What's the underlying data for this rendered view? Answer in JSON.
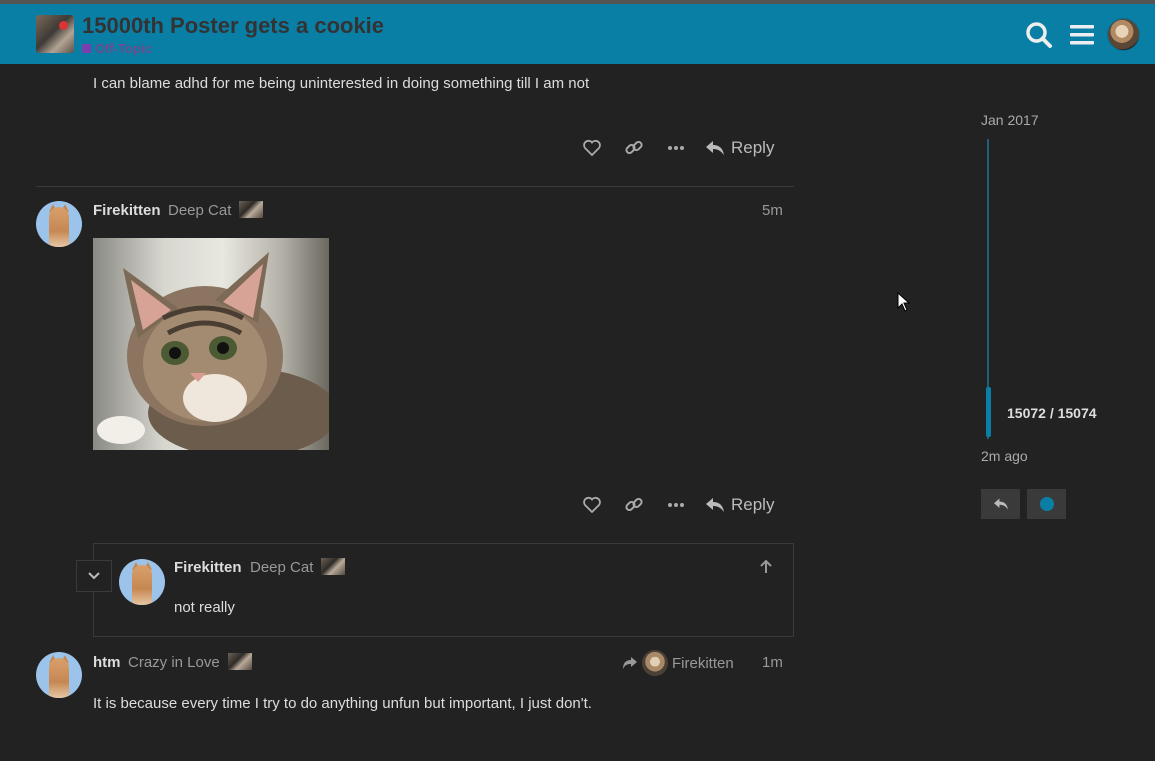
{
  "header": {
    "topic_title": "15000th Poster gets a cookie",
    "category": "Off-Topic",
    "icons": [
      "search-icon",
      "hamburger-menu-icon",
      "user-avatar"
    ]
  },
  "posts": [
    {
      "body": "I can blame adhd for me being uninterested in doing something till I am not",
      "reply_label": "Reply"
    },
    {
      "username": "Firekitten",
      "user_title": "Deep Cat",
      "time": "5m",
      "reply_label": "Reply",
      "image": "kitten-photo"
    },
    {
      "username": "htm",
      "user_title": "Crazy in Love",
      "time": "1m",
      "reply_to": "Firekitten",
      "body": "It is because every time I try to do anything unfun but important, I just don't."
    }
  ],
  "embedded_reply": {
    "username": "Firekitten",
    "user_title": "Deep Cat",
    "body": "not really"
  },
  "timeline": {
    "start_date": "Jan 2017",
    "position": "15072 / 15074",
    "last_activity": "2m ago",
    "progress": 0.9999
  },
  "colors": {
    "header_bg": "#0a7fa6",
    "page_bg": "#222222",
    "accent": "#0a7fa6",
    "category": "#7a3fae"
  }
}
